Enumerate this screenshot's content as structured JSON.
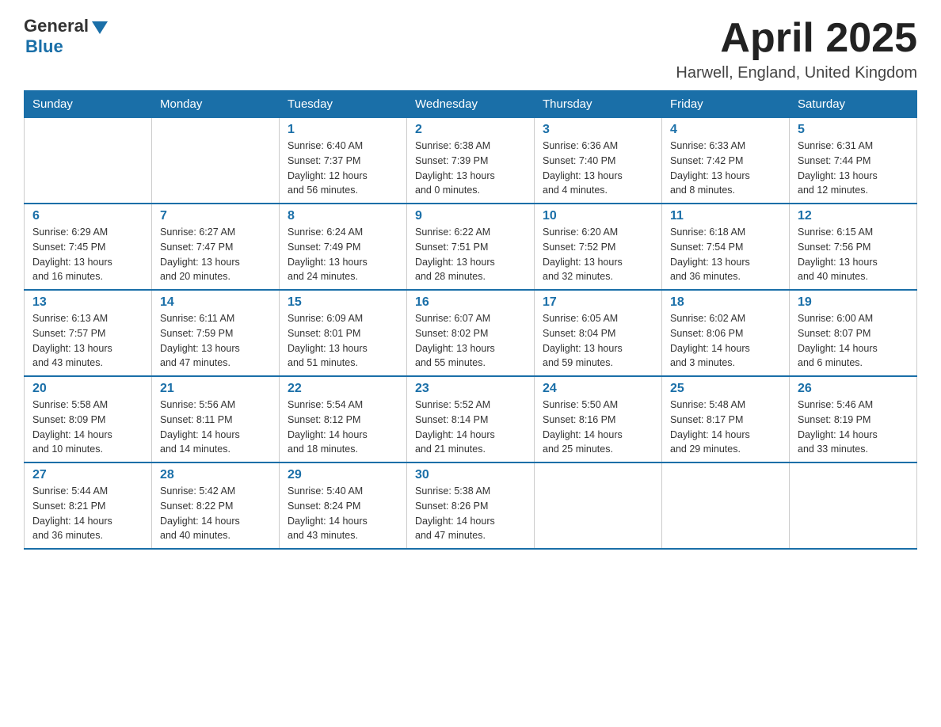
{
  "logo": {
    "general": "General",
    "blue": "Blue"
  },
  "title": {
    "month_year": "April 2025",
    "location": "Harwell, England, United Kingdom"
  },
  "weekdays": [
    "Sunday",
    "Monday",
    "Tuesday",
    "Wednesday",
    "Thursday",
    "Friday",
    "Saturday"
  ],
  "weeks": [
    [
      {
        "day": "",
        "info": []
      },
      {
        "day": "",
        "info": []
      },
      {
        "day": "1",
        "info": [
          "Sunrise: 6:40 AM",
          "Sunset: 7:37 PM",
          "Daylight: 12 hours",
          "and 56 minutes."
        ]
      },
      {
        "day": "2",
        "info": [
          "Sunrise: 6:38 AM",
          "Sunset: 7:39 PM",
          "Daylight: 13 hours",
          "and 0 minutes."
        ]
      },
      {
        "day": "3",
        "info": [
          "Sunrise: 6:36 AM",
          "Sunset: 7:40 PM",
          "Daylight: 13 hours",
          "and 4 minutes."
        ]
      },
      {
        "day": "4",
        "info": [
          "Sunrise: 6:33 AM",
          "Sunset: 7:42 PM",
          "Daylight: 13 hours",
          "and 8 minutes."
        ]
      },
      {
        "day": "5",
        "info": [
          "Sunrise: 6:31 AM",
          "Sunset: 7:44 PM",
          "Daylight: 13 hours",
          "and 12 minutes."
        ]
      }
    ],
    [
      {
        "day": "6",
        "info": [
          "Sunrise: 6:29 AM",
          "Sunset: 7:45 PM",
          "Daylight: 13 hours",
          "and 16 minutes."
        ]
      },
      {
        "day": "7",
        "info": [
          "Sunrise: 6:27 AM",
          "Sunset: 7:47 PM",
          "Daylight: 13 hours",
          "and 20 minutes."
        ]
      },
      {
        "day": "8",
        "info": [
          "Sunrise: 6:24 AM",
          "Sunset: 7:49 PM",
          "Daylight: 13 hours",
          "and 24 minutes."
        ]
      },
      {
        "day": "9",
        "info": [
          "Sunrise: 6:22 AM",
          "Sunset: 7:51 PM",
          "Daylight: 13 hours",
          "and 28 minutes."
        ]
      },
      {
        "day": "10",
        "info": [
          "Sunrise: 6:20 AM",
          "Sunset: 7:52 PM",
          "Daylight: 13 hours",
          "and 32 minutes."
        ]
      },
      {
        "day": "11",
        "info": [
          "Sunrise: 6:18 AM",
          "Sunset: 7:54 PM",
          "Daylight: 13 hours",
          "and 36 minutes."
        ]
      },
      {
        "day": "12",
        "info": [
          "Sunrise: 6:15 AM",
          "Sunset: 7:56 PM",
          "Daylight: 13 hours",
          "and 40 minutes."
        ]
      }
    ],
    [
      {
        "day": "13",
        "info": [
          "Sunrise: 6:13 AM",
          "Sunset: 7:57 PM",
          "Daylight: 13 hours",
          "and 43 minutes."
        ]
      },
      {
        "day": "14",
        "info": [
          "Sunrise: 6:11 AM",
          "Sunset: 7:59 PM",
          "Daylight: 13 hours",
          "and 47 minutes."
        ]
      },
      {
        "day": "15",
        "info": [
          "Sunrise: 6:09 AM",
          "Sunset: 8:01 PM",
          "Daylight: 13 hours",
          "and 51 minutes."
        ]
      },
      {
        "day": "16",
        "info": [
          "Sunrise: 6:07 AM",
          "Sunset: 8:02 PM",
          "Daylight: 13 hours",
          "and 55 minutes."
        ]
      },
      {
        "day": "17",
        "info": [
          "Sunrise: 6:05 AM",
          "Sunset: 8:04 PM",
          "Daylight: 13 hours",
          "and 59 minutes."
        ]
      },
      {
        "day": "18",
        "info": [
          "Sunrise: 6:02 AM",
          "Sunset: 8:06 PM",
          "Daylight: 14 hours",
          "and 3 minutes."
        ]
      },
      {
        "day": "19",
        "info": [
          "Sunrise: 6:00 AM",
          "Sunset: 8:07 PM",
          "Daylight: 14 hours",
          "and 6 minutes."
        ]
      }
    ],
    [
      {
        "day": "20",
        "info": [
          "Sunrise: 5:58 AM",
          "Sunset: 8:09 PM",
          "Daylight: 14 hours",
          "and 10 minutes."
        ]
      },
      {
        "day": "21",
        "info": [
          "Sunrise: 5:56 AM",
          "Sunset: 8:11 PM",
          "Daylight: 14 hours",
          "and 14 minutes."
        ]
      },
      {
        "day": "22",
        "info": [
          "Sunrise: 5:54 AM",
          "Sunset: 8:12 PM",
          "Daylight: 14 hours",
          "and 18 minutes."
        ]
      },
      {
        "day": "23",
        "info": [
          "Sunrise: 5:52 AM",
          "Sunset: 8:14 PM",
          "Daylight: 14 hours",
          "and 21 minutes."
        ]
      },
      {
        "day": "24",
        "info": [
          "Sunrise: 5:50 AM",
          "Sunset: 8:16 PM",
          "Daylight: 14 hours",
          "and 25 minutes."
        ]
      },
      {
        "day": "25",
        "info": [
          "Sunrise: 5:48 AM",
          "Sunset: 8:17 PM",
          "Daylight: 14 hours",
          "and 29 minutes."
        ]
      },
      {
        "day": "26",
        "info": [
          "Sunrise: 5:46 AM",
          "Sunset: 8:19 PM",
          "Daylight: 14 hours",
          "and 33 minutes."
        ]
      }
    ],
    [
      {
        "day": "27",
        "info": [
          "Sunrise: 5:44 AM",
          "Sunset: 8:21 PM",
          "Daylight: 14 hours",
          "and 36 minutes."
        ]
      },
      {
        "day": "28",
        "info": [
          "Sunrise: 5:42 AM",
          "Sunset: 8:22 PM",
          "Daylight: 14 hours",
          "and 40 minutes."
        ]
      },
      {
        "day": "29",
        "info": [
          "Sunrise: 5:40 AM",
          "Sunset: 8:24 PM",
          "Daylight: 14 hours",
          "and 43 minutes."
        ]
      },
      {
        "day": "30",
        "info": [
          "Sunrise: 5:38 AM",
          "Sunset: 8:26 PM",
          "Daylight: 14 hours",
          "and 47 minutes."
        ]
      },
      {
        "day": "",
        "info": []
      },
      {
        "day": "",
        "info": []
      },
      {
        "day": "",
        "info": []
      }
    ]
  ]
}
